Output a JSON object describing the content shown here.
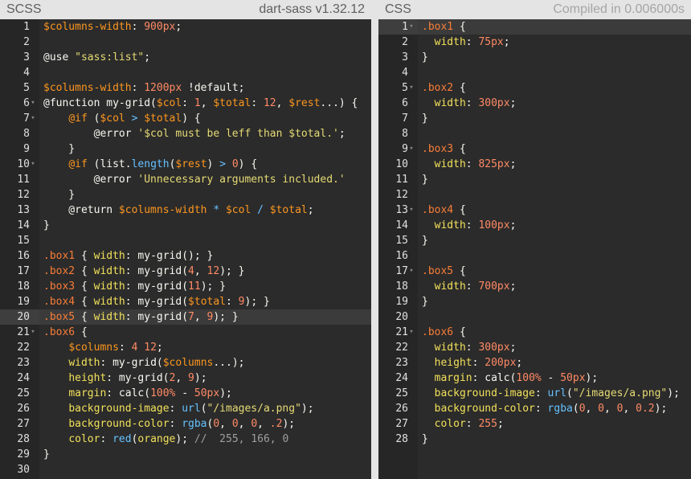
{
  "left_panel": {
    "title": "SCSS",
    "subtitle": "dart-sass v1.32.12"
  },
  "right_panel": {
    "title": "CSS",
    "subtitle": "Compiled in 0.006000s"
  },
  "scss_lines": [
    {
      "n": "1",
      "fold": false,
      "parts": [
        [
          "var",
          "$columns-width"
        ],
        [
          "plain",
          ": "
        ],
        [
          "num",
          "900px"
        ],
        [
          "plain",
          ";"
        ]
      ]
    },
    {
      "n": "2",
      "fold": false,
      "parts": []
    },
    {
      "n": "3",
      "fold": false,
      "parts": [
        [
          "plain",
          "@use "
        ],
        [
          "str",
          "\"sass:list\""
        ],
        [
          "plain",
          ";"
        ]
      ]
    },
    {
      "n": "4",
      "fold": false,
      "parts": []
    },
    {
      "n": "5",
      "fold": false,
      "parts": [
        [
          "var",
          "$columns-width"
        ],
        [
          "plain",
          ": "
        ],
        [
          "num",
          "1200px"
        ],
        [
          "plain",
          " !default;"
        ]
      ]
    },
    {
      "n": "6",
      "fold": true,
      "parts": [
        [
          "plain",
          "@function my-grid("
        ],
        [
          "var",
          "$col"
        ],
        [
          "plain",
          ": "
        ],
        [
          "num",
          "1"
        ],
        [
          "plain",
          ", "
        ],
        [
          "var",
          "$total"
        ],
        [
          "plain",
          ": "
        ],
        [
          "num",
          "12"
        ],
        [
          "plain",
          ", "
        ],
        [
          "var",
          "$rest"
        ],
        [
          "plain",
          "...) {"
        ]
      ]
    },
    {
      "n": "7",
      "fold": true,
      "parts": [
        [
          "plain",
          "    "
        ],
        [
          "var",
          "@if"
        ],
        [
          "plain",
          " ("
        ],
        [
          "var",
          "$col"
        ],
        [
          "plain",
          " "
        ],
        [
          "op",
          ">"
        ],
        [
          "plain",
          " "
        ],
        [
          "var",
          "$total"
        ],
        [
          "plain",
          ") {"
        ]
      ]
    },
    {
      "n": "8",
      "fold": false,
      "parts": [
        [
          "plain",
          "        @error "
        ],
        [
          "str",
          "'$col must be leff than $total.'"
        ],
        [
          "plain",
          ";"
        ]
      ]
    },
    {
      "n": "9",
      "fold": false,
      "parts": [
        [
          "plain",
          "    }"
        ]
      ]
    },
    {
      "n": "10",
      "fold": true,
      "parts": [
        [
          "plain",
          "    "
        ],
        [
          "var",
          "@if"
        ],
        [
          "plain",
          " (list."
        ],
        [
          "fn",
          "length"
        ],
        [
          "plain",
          "("
        ],
        [
          "var",
          "$rest"
        ],
        [
          "plain",
          ") "
        ],
        [
          "op",
          ">"
        ],
        [
          "plain",
          " "
        ],
        [
          "num",
          "0"
        ],
        [
          "plain",
          ") {"
        ]
      ]
    },
    {
      "n": "11",
      "fold": false,
      "parts": [
        [
          "plain",
          "        @error "
        ],
        [
          "str",
          "'Unnecessary arguments included.'"
        ]
      ]
    },
    {
      "n": "12",
      "fold": false,
      "parts": [
        [
          "plain",
          "    }"
        ]
      ]
    },
    {
      "n": "13",
      "fold": false,
      "parts": [
        [
          "plain",
          "    @return "
        ],
        [
          "var",
          "$columns-width"
        ],
        [
          "plain",
          " "
        ],
        [
          "op",
          "*"
        ],
        [
          "plain",
          " "
        ],
        [
          "var",
          "$col"
        ],
        [
          "plain",
          " "
        ],
        [
          "op",
          "/"
        ],
        [
          "plain",
          " "
        ],
        [
          "var",
          "$total"
        ],
        [
          "plain",
          ";"
        ]
      ]
    },
    {
      "n": "14",
      "fold": false,
      "parts": [
        [
          "plain",
          "}"
        ]
      ]
    },
    {
      "n": "15",
      "fold": false,
      "parts": []
    },
    {
      "n": "16",
      "fold": false,
      "parts": [
        [
          "sel",
          ".box1"
        ],
        [
          "plain",
          " { "
        ],
        [
          "prop",
          "width"
        ],
        [
          "plain",
          ": my-grid(); }"
        ]
      ]
    },
    {
      "n": "17",
      "fold": false,
      "parts": [
        [
          "sel",
          ".box2"
        ],
        [
          "plain",
          " { "
        ],
        [
          "prop",
          "width"
        ],
        [
          "plain",
          ": my-grid("
        ],
        [
          "num",
          "4"
        ],
        [
          "plain",
          ", "
        ],
        [
          "num",
          "12"
        ],
        [
          "plain",
          "); }"
        ]
      ]
    },
    {
      "n": "18",
      "fold": false,
      "parts": [
        [
          "sel",
          ".box3"
        ],
        [
          "plain",
          " { "
        ],
        [
          "prop",
          "width"
        ],
        [
          "plain",
          ": my-grid("
        ],
        [
          "num",
          "11"
        ],
        [
          "plain",
          "); }"
        ]
      ]
    },
    {
      "n": "19",
      "fold": false,
      "parts": [
        [
          "sel",
          ".box4"
        ],
        [
          "plain",
          " { "
        ],
        [
          "prop",
          "width"
        ],
        [
          "plain",
          ": my-grid("
        ],
        [
          "var",
          "$total"
        ],
        [
          "plain",
          ": "
        ],
        [
          "num",
          "9"
        ],
        [
          "plain",
          "); }"
        ]
      ]
    },
    {
      "n": "20",
      "fold": false,
      "active": true,
      "parts": [
        [
          "sel",
          ".box5"
        ],
        [
          "plain",
          " { "
        ],
        [
          "prop",
          "width"
        ],
        [
          "plain",
          ": my-grid("
        ],
        [
          "num",
          "7"
        ],
        [
          "plain",
          ", "
        ],
        [
          "num",
          "9"
        ],
        [
          "plain",
          "); }"
        ]
      ]
    },
    {
      "n": "21",
      "fold": true,
      "parts": [
        [
          "sel",
          ".box6"
        ],
        [
          "plain",
          " {"
        ]
      ]
    },
    {
      "n": "22",
      "fold": false,
      "parts": [
        [
          "plain",
          "    "
        ],
        [
          "var",
          "$columns"
        ],
        [
          "plain",
          ": "
        ],
        [
          "num",
          "4"
        ],
        [
          "plain",
          " "
        ],
        [
          "num",
          "12"
        ],
        [
          "plain",
          ";"
        ]
      ]
    },
    {
      "n": "23",
      "fold": false,
      "parts": [
        [
          "plain",
          "    "
        ],
        [
          "prop",
          "width"
        ],
        [
          "plain",
          ": my-grid("
        ],
        [
          "var",
          "$columns"
        ],
        [
          "plain",
          "...);"
        ]
      ]
    },
    {
      "n": "24",
      "fold": false,
      "parts": [
        [
          "plain",
          "    "
        ],
        [
          "prop",
          "height"
        ],
        [
          "plain",
          ": my-grid("
        ],
        [
          "num",
          "2"
        ],
        [
          "plain",
          ", "
        ],
        [
          "num",
          "9"
        ],
        [
          "plain",
          ");"
        ]
      ]
    },
    {
      "n": "25",
      "fold": false,
      "parts": [
        [
          "plain",
          "    "
        ],
        [
          "prop",
          "margin"
        ],
        [
          "plain",
          ": calc("
        ],
        [
          "num",
          "100%"
        ],
        [
          "plain",
          " - "
        ],
        [
          "num",
          "50px"
        ],
        [
          "plain",
          ");"
        ]
      ]
    },
    {
      "n": "26",
      "fold": false,
      "parts": [
        [
          "plain",
          "    "
        ],
        [
          "prop",
          "background-image"
        ],
        [
          "plain",
          ": "
        ],
        [
          "fn",
          "url"
        ],
        [
          "plain",
          "("
        ],
        [
          "str",
          "\"/images/a.png\""
        ],
        [
          "plain",
          ");"
        ]
      ]
    },
    {
      "n": "27",
      "fold": false,
      "parts": [
        [
          "plain",
          "    "
        ],
        [
          "prop",
          "background-color"
        ],
        [
          "plain",
          ": "
        ],
        [
          "fn",
          "rgba"
        ],
        [
          "plain",
          "("
        ],
        [
          "num",
          "0"
        ],
        [
          "plain",
          ", "
        ],
        [
          "num",
          "0"
        ],
        [
          "plain",
          ", "
        ],
        [
          "num",
          "0"
        ],
        [
          "plain",
          ", "
        ],
        [
          "num",
          ".2"
        ],
        [
          "plain",
          ");"
        ]
      ]
    },
    {
      "n": "28",
      "fold": false,
      "parts": [
        [
          "plain",
          "    "
        ],
        [
          "prop",
          "color"
        ],
        [
          "plain",
          ": "
        ],
        [
          "fn",
          "red"
        ],
        [
          "plain",
          "("
        ],
        [
          "prop",
          "orange"
        ],
        [
          "plain",
          "); "
        ],
        [
          "com",
          "//  255, 166, 0"
        ]
      ]
    },
    {
      "n": "29",
      "fold": false,
      "parts": [
        [
          "plain",
          "}"
        ]
      ]
    },
    {
      "n": "30",
      "fold": false,
      "parts": []
    }
  ],
  "css_lines": [
    {
      "n": "1",
      "fold": true,
      "active": true,
      "parts": [
        [
          "sel",
          ".box1"
        ],
        [
          "plain",
          " {"
        ]
      ]
    },
    {
      "n": "2",
      "fold": false,
      "parts": [
        [
          "plain",
          "  "
        ],
        [
          "prop",
          "width"
        ],
        [
          "plain",
          ": "
        ],
        [
          "num",
          "75px"
        ],
        [
          "plain",
          ";"
        ]
      ]
    },
    {
      "n": "3",
      "fold": false,
      "parts": [
        [
          "plain",
          "}"
        ]
      ]
    },
    {
      "n": "4",
      "fold": false,
      "parts": []
    },
    {
      "n": "5",
      "fold": true,
      "parts": [
        [
          "sel",
          ".box2"
        ],
        [
          "plain",
          " {"
        ]
      ]
    },
    {
      "n": "6",
      "fold": false,
      "parts": [
        [
          "plain",
          "  "
        ],
        [
          "prop",
          "width"
        ],
        [
          "plain",
          ": "
        ],
        [
          "num",
          "300px"
        ],
        [
          "plain",
          ";"
        ]
      ]
    },
    {
      "n": "7",
      "fold": false,
      "parts": [
        [
          "plain",
          "}"
        ]
      ]
    },
    {
      "n": "8",
      "fold": false,
      "parts": []
    },
    {
      "n": "9",
      "fold": true,
      "parts": [
        [
          "sel",
          ".box3"
        ],
        [
          "plain",
          " {"
        ]
      ]
    },
    {
      "n": "10",
      "fold": false,
      "parts": [
        [
          "plain",
          "  "
        ],
        [
          "prop",
          "width"
        ],
        [
          "plain",
          ": "
        ],
        [
          "num",
          "825px"
        ],
        [
          "plain",
          ";"
        ]
      ]
    },
    {
      "n": "11",
      "fold": false,
      "parts": [
        [
          "plain",
          "}"
        ]
      ]
    },
    {
      "n": "12",
      "fold": false,
      "parts": []
    },
    {
      "n": "13",
      "fold": true,
      "parts": [
        [
          "sel",
          ".box4"
        ],
        [
          "plain",
          " {"
        ]
      ]
    },
    {
      "n": "14",
      "fold": false,
      "parts": [
        [
          "plain",
          "  "
        ],
        [
          "prop",
          "width"
        ],
        [
          "plain",
          ": "
        ],
        [
          "num",
          "100px"
        ],
        [
          "plain",
          ";"
        ]
      ]
    },
    {
      "n": "15",
      "fold": false,
      "parts": [
        [
          "plain",
          "}"
        ]
      ]
    },
    {
      "n": "16",
      "fold": false,
      "parts": []
    },
    {
      "n": "17",
      "fold": true,
      "parts": [
        [
          "sel",
          ".box5"
        ],
        [
          "plain",
          " {"
        ]
      ]
    },
    {
      "n": "18",
      "fold": false,
      "parts": [
        [
          "plain",
          "  "
        ],
        [
          "prop",
          "width"
        ],
        [
          "plain",
          ": "
        ],
        [
          "num",
          "700px"
        ],
        [
          "plain",
          ";"
        ]
      ]
    },
    {
      "n": "19",
      "fold": false,
      "parts": [
        [
          "plain",
          "}"
        ]
      ]
    },
    {
      "n": "20",
      "fold": false,
      "parts": []
    },
    {
      "n": "21",
      "fold": true,
      "parts": [
        [
          "sel",
          ".box6"
        ],
        [
          "plain",
          " {"
        ]
      ]
    },
    {
      "n": "22",
      "fold": false,
      "parts": [
        [
          "plain",
          "  "
        ],
        [
          "prop",
          "width"
        ],
        [
          "plain",
          ": "
        ],
        [
          "num",
          "300px"
        ],
        [
          "plain",
          ";"
        ]
      ]
    },
    {
      "n": "23",
      "fold": false,
      "parts": [
        [
          "plain",
          "  "
        ],
        [
          "prop",
          "height"
        ],
        [
          "plain",
          ": "
        ],
        [
          "num",
          "200px"
        ],
        [
          "plain",
          ";"
        ]
      ]
    },
    {
      "n": "24",
      "fold": false,
      "parts": [
        [
          "plain",
          "  "
        ],
        [
          "prop",
          "margin"
        ],
        [
          "plain",
          ": calc("
        ],
        [
          "num",
          "100%"
        ],
        [
          "plain",
          " - "
        ],
        [
          "num",
          "50px"
        ],
        [
          "plain",
          ");"
        ]
      ]
    },
    {
      "n": "25",
      "fold": false,
      "parts": [
        [
          "plain",
          "  "
        ],
        [
          "prop",
          "background-image"
        ],
        [
          "plain",
          ": "
        ],
        [
          "fn",
          "url"
        ],
        [
          "plain",
          "("
        ],
        [
          "str",
          "\"/images/a.png\""
        ],
        [
          "plain",
          ");"
        ]
      ]
    },
    {
      "n": "26",
      "fold": false,
      "parts": [
        [
          "plain",
          "  "
        ],
        [
          "prop",
          "background-color"
        ],
        [
          "plain",
          ": "
        ],
        [
          "fn",
          "rgba"
        ],
        [
          "plain",
          "("
        ],
        [
          "num",
          "0"
        ],
        [
          "plain",
          ", "
        ],
        [
          "num",
          "0"
        ],
        [
          "plain",
          ", "
        ],
        [
          "num",
          "0"
        ],
        [
          "plain",
          ", "
        ],
        [
          "num",
          "0.2"
        ],
        [
          "plain",
          ");"
        ]
      ]
    },
    {
      "n": "27",
      "fold": false,
      "parts": [
        [
          "plain",
          "  "
        ],
        [
          "prop",
          "color"
        ],
        [
          "plain",
          ": "
        ],
        [
          "num",
          "255"
        ],
        [
          "plain",
          ";"
        ]
      ]
    },
    {
      "n": "28",
      "fold": false,
      "parts": [
        [
          "plain",
          "}"
        ]
      ]
    }
  ]
}
